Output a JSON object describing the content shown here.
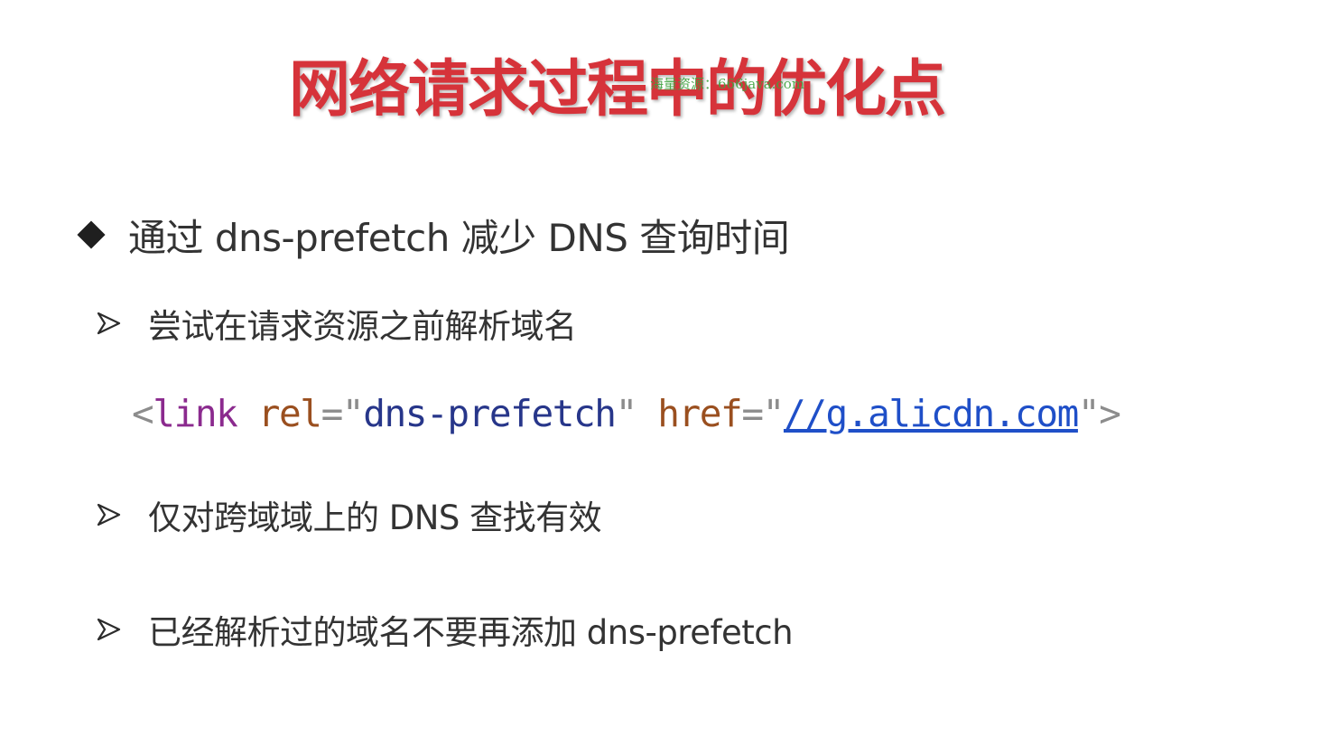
{
  "slide": {
    "title": "网络请求过程中的优化点",
    "watermark": "海量资源：666java.com",
    "main_bullet": "通过 dns-prefetch 减少 DNS 查询时间",
    "sub_bullets": [
      "尝试在请求资源之前解析域名",
      "仅对跨域域上的 DNS 查找有效",
      "已经解析过的域名不要再添加 dns-prefetch"
    ],
    "code": {
      "open": "<",
      "tag": "link",
      "attr1": "rel",
      "eq1": "=",
      "q1": "\"",
      "val1": "dns-prefetch",
      "q2": "\"",
      "attr2": "href",
      "eq2": "=",
      "q3": "\"",
      "link": "//g.alicdn.com",
      "q4": "\"",
      "close": ">"
    },
    "colors": {
      "title": "#d6333a",
      "watermark": "#3fa33f",
      "text": "#333333",
      "code_tag": "#8b2a8e",
      "code_attr": "#9a4f1f",
      "code_string": "#27368a",
      "code_link": "#1f4fc8"
    },
    "icons": {
      "main_bullet": "diamond-bullet-icon",
      "sub_bullet": "arrowhead-bullet-icon"
    }
  }
}
